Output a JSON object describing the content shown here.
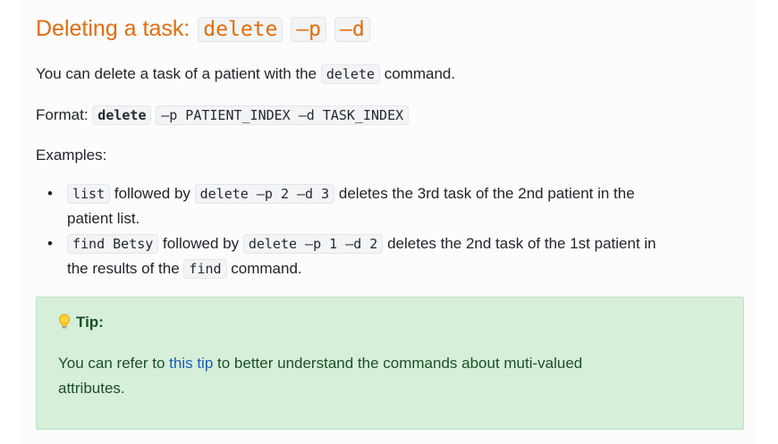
{
  "heading": {
    "text": "Deleting a task:",
    "code1": "delete",
    "code2": "–p",
    "code3": "–d"
  },
  "intro": {
    "before": "You can delete a task of a patient with the",
    "code": "delete",
    "after": "command."
  },
  "format": {
    "label": "Format:",
    "cmd": "delete",
    "args": "–p PATIENT_INDEX –d TASK_INDEX"
  },
  "examples_label": "Examples:",
  "examples": [
    {
      "code1": "list",
      "mid": "followed by",
      "code2": "delete –p 2 –d 3",
      "rest": "deletes the 3rd task of the 2nd patient in the",
      "line2": "patient list."
    },
    {
      "code1": "find Betsy",
      "mid": "followed by",
      "code2": "delete –p 1 –d 2",
      "rest": "deletes the 2nd task of the 1st patient in",
      "line2_before": "the results of the",
      "line2_code": "find",
      "line2_after": "command."
    }
  ],
  "tip": {
    "title": "Tip:",
    "before_link": "You can refer to",
    "link": "this tip",
    "after_link": "to better understand the commands about muti-valued",
    "line2": "attributes."
  },
  "colors": {
    "heading": "#e46c0a",
    "tip_bg": "#d5efd9",
    "link": "#1b5bb6"
  }
}
